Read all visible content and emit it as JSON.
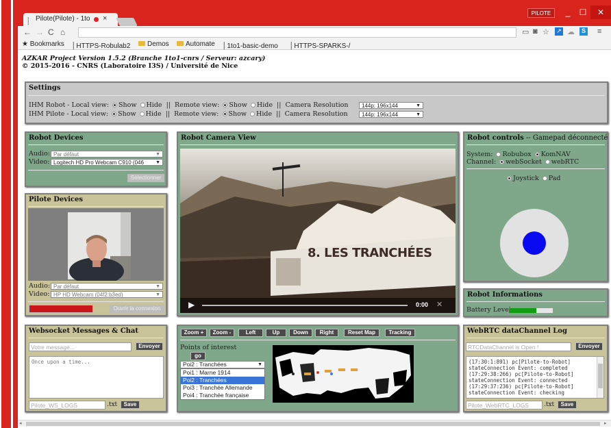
{
  "browser": {
    "tab_title": "Pilote(Pilote) - 1to",
    "tab_close": "×",
    "profile_badge": "PILOTE",
    "url": "",
    "bookmarks": [
      {
        "label": "Bookmarks"
      },
      {
        "label": "HTTPS-Robulab2"
      },
      {
        "label": "Demos"
      },
      {
        "label": "Automate"
      },
      {
        "label": "1to1-basic-demo"
      },
      {
        "label": "HTTPS-SPARKS-/"
      }
    ]
  },
  "header": {
    "line1": "AZKAR Project Version 1.5.2 (Branche 1to1-cnrs / Serveur: azcary)",
    "line2": "© 2015-2016 - CNRS (Laboratoire I3S) / Université de Nice"
  },
  "settings": {
    "title": "Settings",
    "rows": [
      {
        "label": "IHM Robot - Local view:",
        "remote": "Remote view:",
        "camres": "Camera Resolution",
        "res_value": "144p: 196x144"
      },
      {
        "label": "IHM Pilote - Local view:",
        "remote": "Remote view:",
        "camres": "Camera Resolution",
        "res_value": "144p: 196x144"
      }
    ],
    "show": "Show",
    "hide": "Hide",
    "sep": "||"
  },
  "robot_devices": {
    "title": "Robot Devices",
    "audio_label": "Audio:",
    "audio_value": "Par défaut",
    "video_label": "Video:",
    "video_value": "Logitech HD Pro Webcam C910 (046",
    "select_button": "Sélectionner"
  },
  "pilote_devices": {
    "title": "Pilote Devices",
    "audio_label": "Audio:",
    "audio_value": "Par défaut",
    "video_label": "Video:",
    "video_value": "HP HD Webcam (04f2:b3ed)",
    "btn_left": "",
    "btn_open": "Ouvrir la connexion"
  },
  "camera_view": {
    "title": "Robot Camera View",
    "sign_text": "8. LES TRANCHÉES",
    "time": "0:00"
  },
  "robot_controls": {
    "title": "Robot controls",
    "subtitle": " -- Gamepad déconnecté !",
    "system_label": "System:",
    "system_options": [
      "Robubox",
      "KomNAV"
    ],
    "channel_label": "Channel:",
    "channel_options": [
      "webSocket",
      "webRTC"
    ],
    "mode_options": [
      "Joystick",
      "Pad"
    ]
  },
  "robot_info": {
    "title": "Robot Informations",
    "battery_label": "Battery Level:",
    "battery_level": 0.62
  },
  "websocket": {
    "title": "Websocket Messages & Chat",
    "message_placeholder": "Votre message...",
    "send": "Envoyer",
    "log_text": "Once upon a time...",
    "file_name": "Pilote_WS_LOGS",
    "file_ext": ".txt",
    "save": "Save"
  },
  "map": {
    "buttons": [
      "Zoom +",
      "Zoom -",
      "Left",
      "Up",
      "Down",
      "Right",
      "Reset Map",
      "Tracking"
    ],
    "poi_title": "Points of interest",
    "go": "go",
    "poi_selected": "Poi2 : Tranchées",
    "poi_options": [
      "Poi1 : Marne 1914",
      "Poi2 : Tranchées",
      "Poi3 : Tranchée Allemande",
      "Poi4 : Tranchée française"
    ]
  },
  "webrtc_log": {
    "title": "WebRTC dataChannel Log",
    "status_text": "RTCDataChannel is Open !",
    "send": "Envoyer",
    "log_text": "(17:30:1:891) pc[Pilote-to-Robot]\nstateConnection Event: completed\n(17:29:38:266) pc[Pilote-to-Robot]\nstateConnection Event: connected\n(17:29:37:236) pc[Pilote-to-Robot]\nstateConnection Event: checking",
    "file_name": "Pilote_WebRTC_LOGS",
    "file_ext": ".txt",
    "save": "Save"
  },
  "colors": {
    "frame_red": "#d9231d",
    "panel_grey": "#c8c8c8",
    "panel_green": "#7fa88a",
    "panel_khaki": "#c9c39a",
    "joystick_blue": "#0a0af0",
    "battery_green": "#129c12"
  }
}
